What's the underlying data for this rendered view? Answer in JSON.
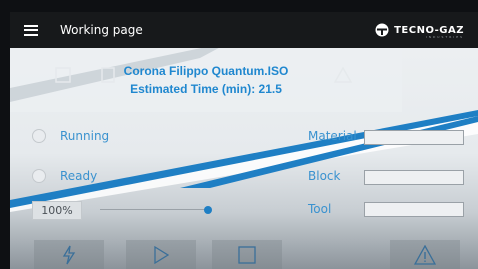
{
  "appbar": {
    "title": "Working page",
    "brand": "TECNO-GAZ",
    "brand_tagline": "INDUSTRIES"
  },
  "job": {
    "file_name": "Corona Filippo Quantum.ISO",
    "estimated_time": "Estimated Time (min): 21.5"
  },
  "status": {
    "running_label": "Running",
    "ready_label": "Ready"
  },
  "fields": {
    "material_label": "Material",
    "material_value": "",
    "block_label": "Block",
    "block_value": "",
    "tool_label": "Tool",
    "tool_value": ""
  },
  "speed": {
    "zoom_label": "100%",
    "slider_level": 1.0
  },
  "colors": {
    "accent": "#1f87cf",
    "appbar": "#17191b"
  },
  "icons": {
    "menu": "hamburger-icon",
    "brand": "tecno-gaz-logo",
    "bottom": [
      "lightning-icon",
      "play-icon",
      "stop-icon",
      "warning-icon"
    ]
  }
}
